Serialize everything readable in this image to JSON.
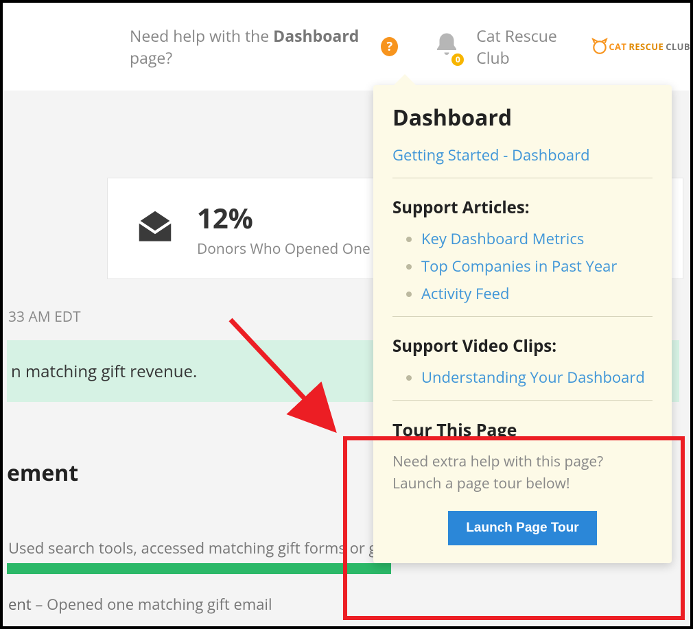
{
  "header": {
    "help_prefix": "Need help with the ",
    "help_bold": "Dashboard",
    "help_suffix": " page?",
    "help_icon_glyph": "?",
    "bell_badge": "0",
    "org_name": "Cat Rescue Club",
    "logo_cat": "CAT",
    "logo_rescue": "RESCUE",
    "logo_club": "CLUB"
  },
  "stat": {
    "percent": "12%",
    "label": "Donors Who Opened One or M"
  },
  "timestamp": "33 AM EDT",
  "green_banner": "n matching gift revenue.",
  "section_heading": "ement",
  "row1": "Used search tools, accessed matching gift forms or g",
  "row2_prefix": "ent",
  "row2_suffix": " – Opened one matching gift email",
  "popover": {
    "title": "Dashboard",
    "getting_started": "Getting Started - Dashboard",
    "support_articles_heading": "Support Articles:",
    "articles": [
      "Key Dashboard Metrics",
      "Top Companies in Past Year",
      "Activity Feed"
    ],
    "support_videos_heading": "Support Video Clips:",
    "videos": [
      "Understanding Your Dashboard"
    ],
    "tour_heading": "Tour This Page",
    "tour_desc": "Need extra help with this page? Launch a page tour below!",
    "launch_label": "Launch Page Tour"
  }
}
